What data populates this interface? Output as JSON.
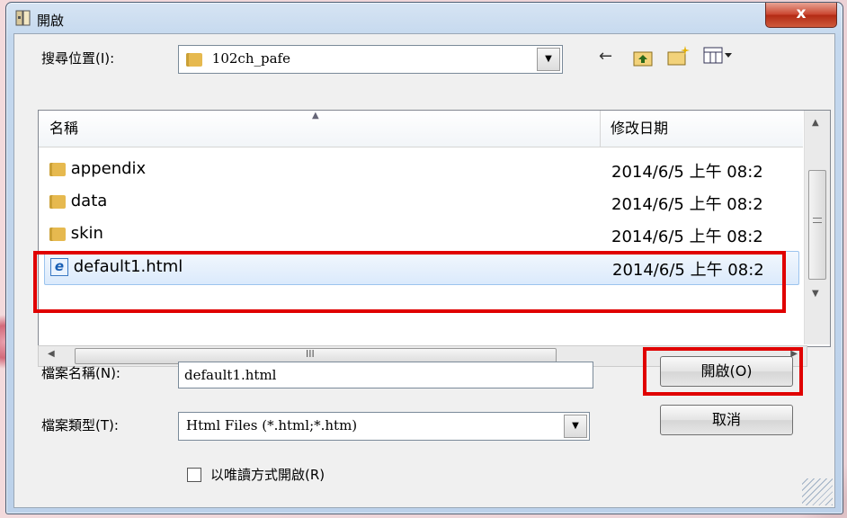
{
  "window": {
    "title": "開啟",
    "close_label": "x"
  },
  "lookin": {
    "label": "搜尋位置(I):",
    "value": "102ch_pafe"
  },
  "list": {
    "columns": [
      "名稱",
      "修改日期"
    ],
    "rows": [
      {
        "name": "appendix",
        "date": "2014/6/5 上午 08:2",
        "icon": "folder-icon"
      },
      {
        "name": "data",
        "date": "2014/6/5 上午 08:2",
        "icon": "folder-icon"
      },
      {
        "name": "skin",
        "date": "2014/6/5 上午 08:2",
        "icon": "folder-icon"
      },
      {
        "name": "default1.html",
        "date": "2014/6/5 上午 08:2",
        "icon": "ie-html-icon",
        "selected": true
      }
    ],
    "hscroll_mark": "III"
  },
  "filename": {
    "label": "檔案名稱(N):",
    "value": "default1.html"
  },
  "filetype": {
    "label": "檔案類型(T):",
    "value": "Html Files (*.html;*.htm)"
  },
  "readonly": {
    "label": "以唯讀方式開啟(R)",
    "checked": false
  },
  "buttons": {
    "open": "開啟(O)",
    "cancel": "取消"
  },
  "colors": {
    "highlight_box": "#e00000",
    "selection": "#dbeafc"
  }
}
